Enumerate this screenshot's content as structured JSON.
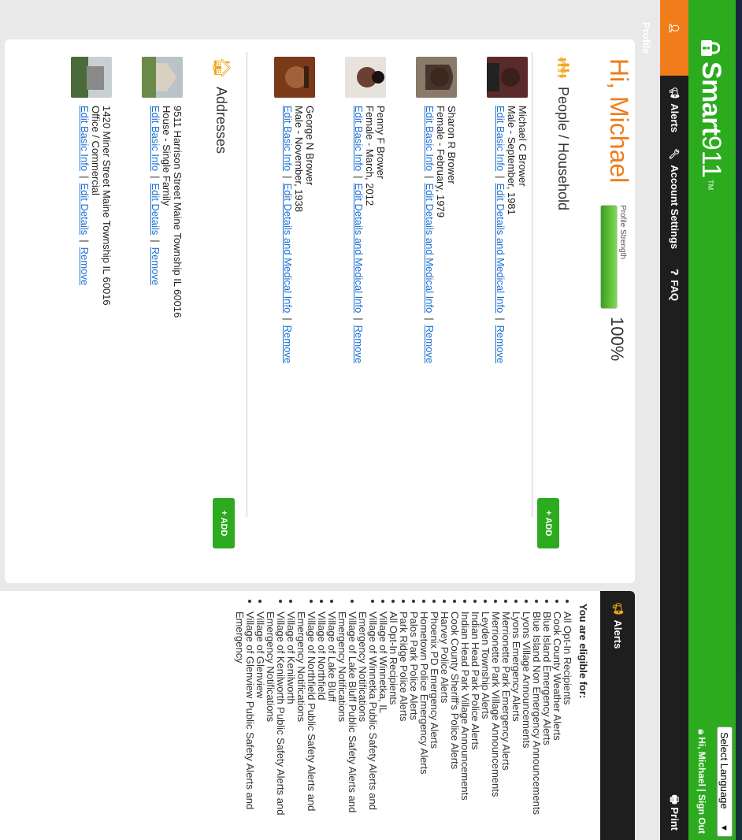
{
  "header": {
    "brand_bold": "Smart",
    "brand_light": "911",
    "brand_tm": "TM",
    "language_select": "Select Language",
    "greeting_link": "Hi, Michael",
    "signout_link": "Sign Out",
    "print_label": "Print",
    "colors": {
      "brand_green": "#2cab1f",
      "active_orange": "#f07d1a"
    }
  },
  "nav": [
    {
      "label": "Profile",
      "icon": "person-icon",
      "active": true
    },
    {
      "label": "Alerts",
      "icon": "megaphone-icon"
    },
    {
      "label": "Account Settings",
      "icon": "wrench-icon"
    },
    {
      "label": "FAQ",
      "icon": "help-icon"
    }
  ],
  "profile": {
    "greeting": "Hi, Michael",
    "strength_label": "Profile Strength",
    "strength_value": "100%",
    "strength_fraction": 1.0
  },
  "people": {
    "title": "People / Household",
    "add_label": "ADD",
    "members": [
      {
        "name": "Michael C Brower",
        "detail": "Male - September, 1981",
        "link1": "Edit Basic Info",
        "link2": "Edit Details and Medical Info",
        "link3": "Remove"
      },
      {
        "name": "Sharon R Brower",
        "detail": "Female - February, 1979",
        "link1": "Edit Basic Info",
        "link2": "Edit Details and Medical Info",
        "link3": "Remove"
      },
      {
        "name": "Penny F Brower",
        "detail": "Female - March, 2012",
        "link1": "Edit Basic Info",
        "link2": "Edit Details and Medical Info",
        "link3": "Remove"
      },
      {
        "name": "George N Brower",
        "detail": "Male - November, 1938",
        "link1": "Edit Basic Info",
        "link2": "Edit Details and Medical Info",
        "link3": "Remove"
      }
    ]
  },
  "addresses": {
    "title": "Addresses",
    "add_label": "ADD",
    "items": [
      {
        "address": "9511 Harrison Street Maine Township IL 60016",
        "type": "House - Single Family",
        "link1": "Edit Basic Info",
        "link2": "Edit Details",
        "link3": "Remove"
      },
      {
        "address": "1420 Miner Street Maine Township IL 60016",
        "type": "Office / Commercial",
        "link1": "Edit Basic Info",
        "link2": "Edit Details",
        "link3": "Remove"
      }
    ]
  },
  "alerts": {
    "title": "Alerts",
    "eligible_heading": "You are eligible for:",
    "items": [
      "All Opt-In Recipients",
      "Cook County Weather Alerts",
      "Blue Island Emergency Alerts",
      "Blue Island Non Emergency Announcements",
      "Lyons Village Announcements",
      "Lyons Emergency Alerts",
      "Merrionette Park Emergency Alerts",
      "Merrionette Park Village Announcements",
      "Leyden Township Alerts",
      "Indian Head Park Police Alerts",
      "Indian Head Park Village Announcements",
      "Cook County Sheriff's Police Alerts",
      "Harvey Police Alerts",
      "Phoenix PD Emergency Alerts",
      "Hometown Police Emergency Alerts",
      "Palos Park Police Alerts",
      "Park Ridge Police Alerts",
      "All Opt-In Recipients",
      "Village of Winnetka, IL",
      "Village of Winnetka Public Safety Alerts and Emergency Notifications",
      "Village of Lake Bluff Public Safety Alerts and Emergency Notifications",
      "Village of Lake Bluff",
      "Village of Northfield",
      "Village of Northfield Public Safety Alerts and Emergency Notifications",
      "Village of Kenilworth",
      "Village of Kenilworth Public Safety Alerts and Emergency Notifications",
      "Village of Glenview",
      "Village of Glenview Public Safety Alerts and Emergency"
    ]
  }
}
